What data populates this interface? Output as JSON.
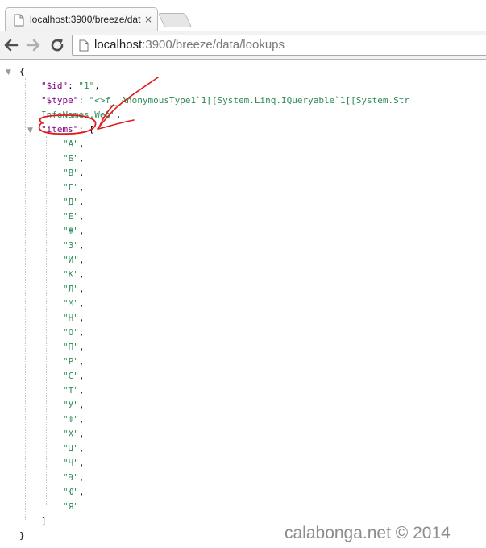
{
  "browser": {
    "tab": {
      "title": "localhost:3900/breeze/dat",
      "close_glyph": "×",
      "favicon": "page-icon"
    },
    "toolbar": {
      "back_icon": "arrow-left-icon",
      "forward_icon": "arrow-right-icon",
      "reload_icon": "reload-icon",
      "url_host": "localhost",
      "url_rest": ":3900/breeze/data/lookups"
    }
  },
  "json_view": {
    "open_brace": "{",
    "close_brace": "}",
    "id_key": "\"$id\"",
    "id_value": "\"1\"",
    "type_key": "\"$type\"",
    "type_value_line1": "\"<>f__AnonymousType1`1[[System.Linq.IQueryable`1[[System.Str",
    "type_value_line2": "InfoNames.Web\"",
    "items_key": "\"items\"",
    "open_bracket": "[",
    "close_bracket": "]",
    "items": [
      "\"А\"",
      "\"Б\"",
      "\"В\"",
      "\"Г\"",
      "\"Д\"",
      "\"Е\"",
      "\"Ж\"",
      "\"З\"",
      "\"И\"",
      "\"К\"",
      "\"Л\"",
      "\"М\"",
      "\"Н\"",
      "\"О\"",
      "\"П\"",
      "\"Р\"",
      "\"С\"",
      "\"Т\"",
      "\"У\"",
      "\"Ф\"",
      "\"Х\"",
      "\"Ц\"",
      "\"Ч\"",
      "\"Э\"",
      "\"Ю\"",
      "\"Я\""
    ],
    "toggle_glyph": "▼",
    "key_color": "#800080",
    "string_color": "#2e8b57"
  },
  "annotation": {
    "color": "#e0191f",
    "shapes": [
      "ellipse around items key",
      "arrow pointing to items key"
    ]
  },
  "watermark": "calabonga.net © 2014"
}
